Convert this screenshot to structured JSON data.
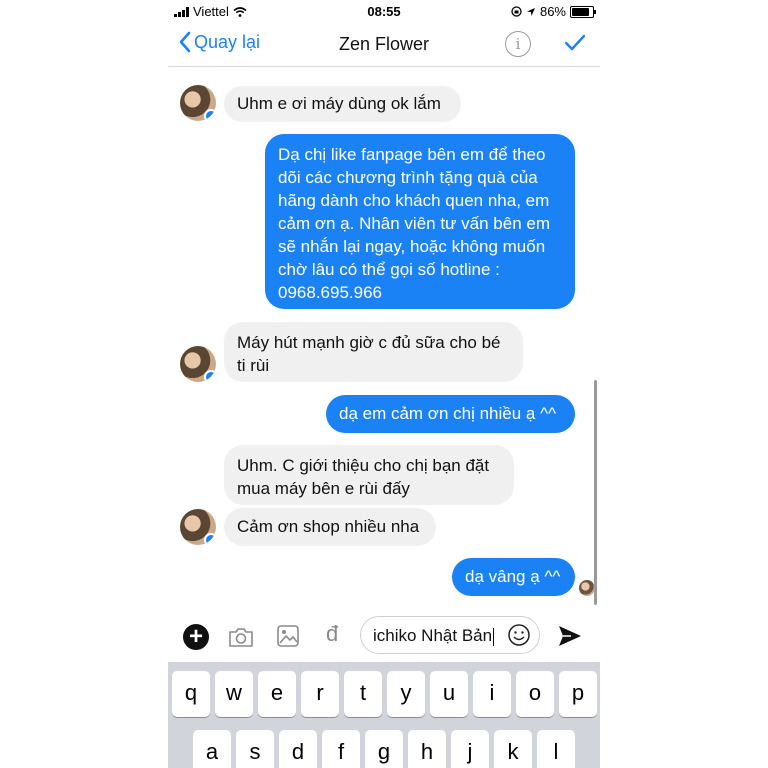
{
  "status_bar": {
    "carrier": "Viettel",
    "time": "08:55",
    "battery": "86%",
    "battery_level": 0.86
  },
  "nav": {
    "back_label": "Quay lại",
    "title": "Zen Flower",
    "info_icon": "info-icon",
    "done_icon": "checkmark-icon"
  },
  "messages": [
    {
      "side": "in",
      "text": "Uhm e ơi máy dùng ok lắm"
    },
    {
      "side": "out",
      "text": "Dạ chị like fanpage bên em để theo dõi các chương trình tặng quà của hãng dành cho khách quen nha, em cảm ơn ạ. Nhân viên tư vấn bên em sẽ nhắn lại ngay, hoặc không muốn chờ lâu có thể gọi số hotline : 0968.695.966"
    },
    {
      "side": "in",
      "text": "Máy hút mạnh giờ c đủ sữa cho bé ti rùi"
    },
    {
      "side": "out",
      "text": "dạ em cảm ơn chị nhiều ạ ^^"
    },
    {
      "side": "in",
      "text": "Uhm. C giới thiệu cho chị bạn đặt mua máy bên e rùi đấy"
    },
    {
      "side": "in",
      "text": "Cảm ơn shop nhiều nha"
    },
    {
      "side": "out",
      "text": "dạ vâng ạ ^^"
    }
  ],
  "composer": {
    "input_value": "ichiko Nhật Bản",
    "currency_symbol": "đ"
  },
  "keyboard": {
    "row1": [
      "q",
      "w",
      "e",
      "r",
      "t",
      "y",
      "u",
      "i",
      "o",
      "p"
    ],
    "row2": [
      "a",
      "s",
      "d",
      "f",
      "g",
      "h",
      "j",
      "k",
      "l"
    ]
  },
  "colors": {
    "accent": "#1a82f5",
    "incoming_bubble": "#f0f0f0",
    "keyboard_bg": "#d1d5db"
  }
}
